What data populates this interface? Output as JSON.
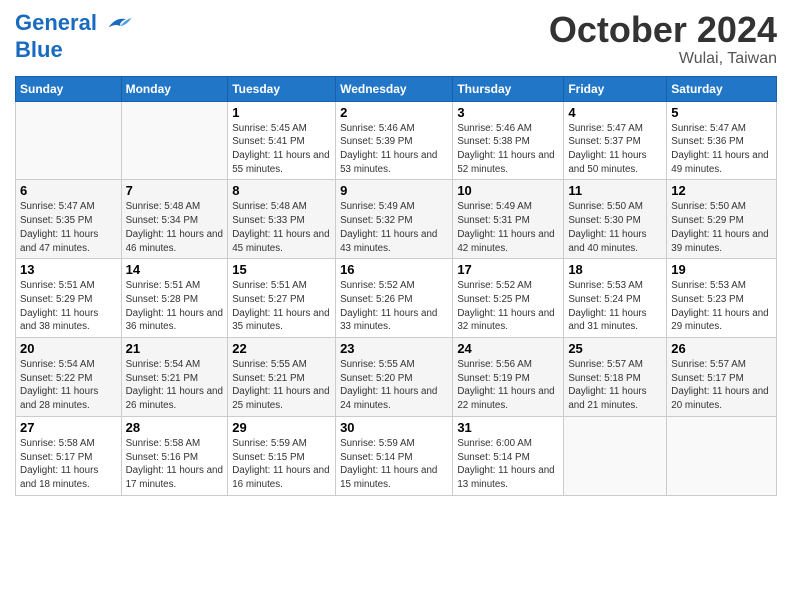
{
  "header": {
    "logo_line1": "General",
    "logo_line2": "Blue",
    "month": "October 2024",
    "location": "Wulai, Taiwan"
  },
  "days_of_week": [
    "Sunday",
    "Monday",
    "Tuesday",
    "Wednesday",
    "Thursday",
    "Friday",
    "Saturday"
  ],
  "weeks": [
    [
      {
        "num": "",
        "info": ""
      },
      {
        "num": "",
        "info": ""
      },
      {
        "num": "1",
        "info": "Sunrise: 5:45 AM\nSunset: 5:41 PM\nDaylight: 11 hours and 55 minutes."
      },
      {
        "num": "2",
        "info": "Sunrise: 5:46 AM\nSunset: 5:39 PM\nDaylight: 11 hours and 53 minutes."
      },
      {
        "num": "3",
        "info": "Sunrise: 5:46 AM\nSunset: 5:38 PM\nDaylight: 11 hours and 52 minutes."
      },
      {
        "num": "4",
        "info": "Sunrise: 5:47 AM\nSunset: 5:37 PM\nDaylight: 11 hours and 50 minutes."
      },
      {
        "num": "5",
        "info": "Sunrise: 5:47 AM\nSunset: 5:36 PM\nDaylight: 11 hours and 49 minutes."
      }
    ],
    [
      {
        "num": "6",
        "info": "Sunrise: 5:47 AM\nSunset: 5:35 PM\nDaylight: 11 hours and 47 minutes."
      },
      {
        "num": "7",
        "info": "Sunrise: 5:48 AM\nSunset: 5:34 PM\nDaylight: 11 hours and 46 minutes."
      },
      {
        "num": "8",
        "info": "Sunrise: 5:48 AM\nSunset: 5:33 PM\nDaylight: 11 hours and 45 minutes."
      },
      {
        "num": "9",
        "info": "Sunrise: 5:49 AM\nSunset: 5:32 PM\nDaylight: 11 hours and 43 minutes."
      },
      {
        "num": "10",
        "info": "Sunrise: 5:49 AM\nSunset: 5:31 PM\nDaylight: 11 hours and 42 minutes."
      },
      {
        "num": "11",
        "info": "Sunrise: 5:50 AM\nSunset: 5:30 PM\nDaylight: 11 hours and 40 minutes."
      },
      {
        "num": "12",
        "info": "Sunrise: 5:50 AM\nSunset: 5:29 PM\nDaylight: 11 hours and 39 minutes."
      }
    ],
    [
      {
        "num": "13",
        "info": "Sunrise: 5:51 AM\nSunset: 5:29 PM\nDaylight: 11 hours and 38 minutes."
      },
      {
        "num": "14",
        "info": "Sunrise: 5:51 AM\nSunset: 5:28 PM\nDaylight: 11 hours and 36 minutes."
      },
      {
        "num": "15",
        "info": "Sunrise: 5:51 AM\nSunset: 5:27 PM\nDaylight: 11 hours and 35 minutes."
      },
      {
        "num": "16",
        "info": "Sunrise: 5:52 AM\nSunset: 5:26 PM\nDaylight: 11 hours and 33 minutes."
      },
      {
        "num": "17",
        "info": "Sunrise: 5:52 AM\nSunset: 5:25 PM\nDaylight: 11 hours and 32 minutes."
      },
      {
        "num": "18",
        "info": "Sunrise: 5:53 AM\nSunset: 5:24 PM\nDaylight: 11 hours and 31 minutes."
      },
      {
        "num": "19",
        "info": "Sunrise: 5:53 AM\nSunset: 5:23 PM\nDaylight: 11 hours and 29 minutes."
      }
    ],
    [
      {
        "num": "20",
        "info": "Sunrise: 5:54 AM\nSunset: 5:22 PM\nDaylight: 11 hours and 28 minutes."
      },
      {
        "num": "21",
        "info": "Sunrise: 5:54 AM\nSunset: 5:21 PM\nDaylight: 11 hours and 26 minutes."
      },
      {
        "num": "22",
        "info": "Sunrise: 5:55 AM\nSunset: 5:21 PM\nDaylight: 11 hours and 25 minutes."
      },
      {
        "num": "23",
        "info": "Sunrise: 5:55 AM\nSunset: 5:20 PM\nDaylight: 11 hours and 24 minutes."
      },
      {
        "num": "24",
        "info": "Sunrise: 5:56 AM\nSunset: 5:19 PM\nDaylight: 11 hours and 22 minutes."
      },
      {
        "num": "25",
        "info": "Sunrise: 5:57 AM\nSunset: 5:18 PM\nDaylight: 11 hours and 21 minutes."
      },
      {
        "num": "26",
        "info": "Sunrise: 5:57 AM\nSunset: 5:17 PM\nDaylight: 11 hours and 20 minutes."
      }
    ],
    [
      {
        "num": "27",
        "info": "Sunrise: 5:58 AM\nSunset: 5:17 PM\nDaylight: 11 hours and 18 minutes."
      },
      {
        "num": "28",
        "info": "Sunrise: 5:58 AM\nSunset: 5:16 PM\nDaylight: 11 hours and 17 minutes."
      },
      {
        "num": "29",
        "info": "Sunrise: 5:59 AM\nSunset: 5:15 PM\nDaylight: 11 hours and 16 minutes."
      },
      {
        "num": "30",
        "info": "Sunrise: 5:59 AM\nSunset: 5:14 PM\nDaylight: 11 hours and 15 minutes."
      },
      {
        "num": "31",
        "info": "Sunrise: 6:00 AM\nSunset: 5:14 PM\nDaylight: 11 hours and 13 minutes."
      },
      {
        "num": "",
        "info": ""
      },
      {
        "num": "",
        "info": ""
      }
    ]
  ]
}
